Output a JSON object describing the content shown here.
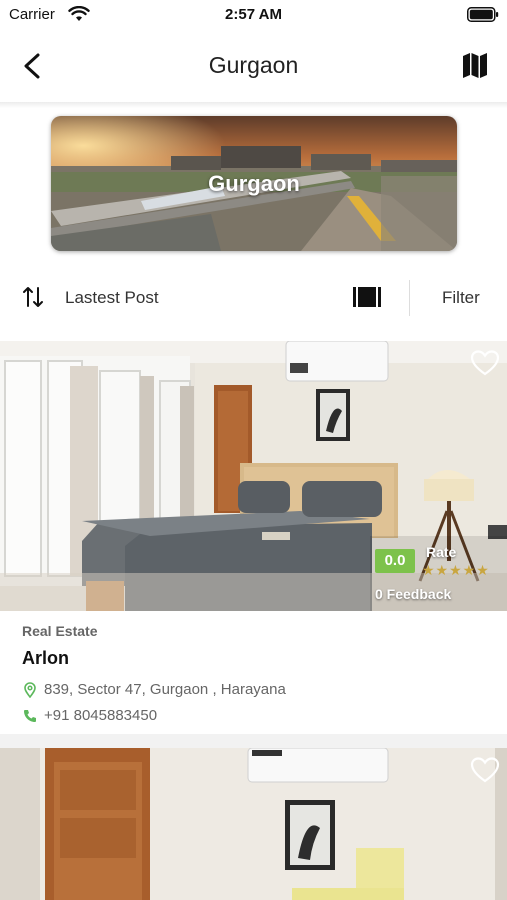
{
  "status_bar": {
    "carrier": "Carrier",
    "time": "2:57 AM",
    "wifi_icon": "wifi-icon",
    "battery_icon": "battery-icon"
  },
  "nav": {
    "title": "Gurgaon",
    "back_icon": "chevron-left-icon",
    "map_icon": "map-icon"
  },
  "banner": {
    "title": "Gurgaon"
  },
  "sort_bar": {
    "sort_icon": "sort-arrows-icon",
    "sort_label": "Lastest Post",
    "view_icon": "view-toggle-icon",
    "filter_label": "Filter"
  },
  "listings": [
    {
      "category": "Real Estate",
      "name": "Arlon",
      "address": "839, Sector 47, Gurgaon , Harayana",
      "phone": "+91 8045883450",
      "rating": "0.0",
      "rating_label": "Rate",
      "stars": "★★★★★",
      "stars_filled": 0,
      "feedback": "0 Feedback",
      "favorite_icon": "heart-outline-icon"
    },
    {
      "favorite_icon": "heart-outline-icon"
    }
  ],
  "colors": {
    "rating_badge": "#7dc24b",
    "location_icon": "#5cb85c",
    "phone_icon": "#5cb85c",
    "star_color": "#c9a640"
  }
}
